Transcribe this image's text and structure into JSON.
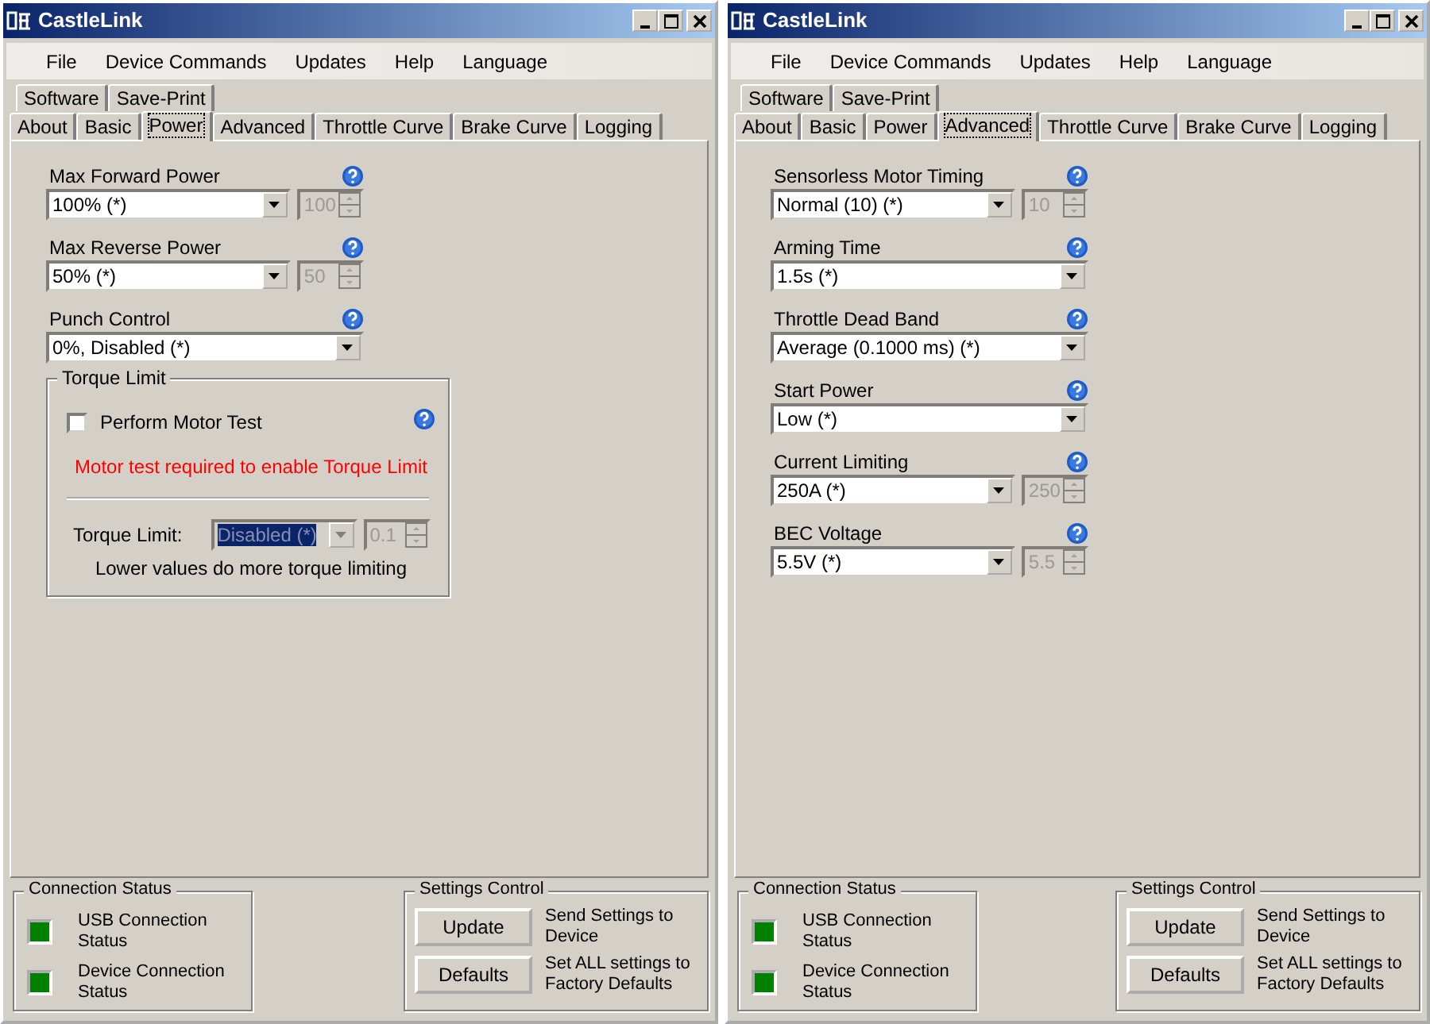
{
  "windows": [
    {
      "title": "CastleLink",
      "menu": [
        "File",
        "Device Commands",
        "Updates",
        "Help",
        "Language"
      ],
      "tab_rows": [
        [
          {
            "label": "Software",
            "selected": false
          },
          {
            "label": "Save-Print",
            "selected": false
          }
        ],
        [
          {
            "label": "About",
            "selected": false
          },
          {
            "label": "Basic",
            "selected": false
          },
          {
            "label": "Power",
            "selected": true
          },
          {
            "label": "Advanced",
            "selected": false
          },
          {
            "label": "Throttle Curve",
            "selected": false
          },
          {
            "label": "Brake Curve",
            "selected": false
          },
          {
            "label": "Logging",
            "selected": false
          }
        ]
      ],
      "settings": [
        {
          "kind": "combo-spin",
          "label": "Max Forward Power",
          "value": "100% (*)",
          "spin": "100"
        },
        {
          "kind": "combo-spin",
          "label": "Max Reverse Power",
          "value": "50% (*)",
          "spin": "50"
        },
        {
          "kind": "combo",
          "label": "Punch Control",
          "value": "0%, Disabled (*)"
        }
      ],
      "torque_limit": {
        "title": "Torque Limit",
        "checkbox": {
          "label": "Perform Motor Test",
          "checked": false
        },
        "warning": "Motor test required to enable Torque Limit",
        "limit_label": "Torque Limit:",
        "limit_value": "Disabled (*)",
        "limit_spin": "0.1",
        "disabled": true,
        "note": "Lower values do more torque limiting"
      },
      "connection_status": {
        "title": "Connection Status",
        "items": [
          {
            "label": "USB Connection Status",
            "on": true
          },
          {
            "label": "Device Connection Status",
            "on": true
          }
        ]
      },
      "settings_control": {
        "title": "Settings Control",
        "buttons": [
          {
            "label": "Update",
            "description": "Send Settings to Device"
          },
          {
            "label": "Defaults",
            "description": "Set ALL settings to Factory Defaults"
          }
        ]
      }
    },
    {
      "title": "CastleLink",
      "menu": [
        "File",
        "Device Commands",
        "Updates",
        "Help",
        "Language"
      ],
      "tab_rows": [
        [
          {
            "label": "Software",
            "selected": false
          },
          {
            "label": "Save-Print",
            "selected": false
          }
        ],
        [
          {
            "label": "About",
            "selected": false
          },
          {
            "label": "Basic",
            "selected": false
          },
          {
            "label": "Power",
            "selected": false
          },
          {
            "label": "Advanced",
            "selected": true
          },
          {
            "label": "Throttle Curve",
            "selected": false
          },
          {
            "label": "Brake Curve",
            "selected": false
          },
          {
            "label": "Logging",
            "selected": false
          }
        ]
      ],
      "settings": [
        {
          "kind": "combo-spin",
          "label": "Sensorless Motor Timing",
          "value": "Normal (10) (*)",
          "spin": "10"
        },
        {
          "kind": "combo",
          "label": "Arming Time",
          "value": "1.5s (*)"
        },
        {
          "kind": "combo",
          "label": "Throttle Dead Band",
          "value": "Average (0.1000 ms) (*)"
        },
        {
          "kind": "combo",
          "label": "Start Power",
          "value": "Low (*)"
        },
        {
          "kind": "combo-spin",
          "label": "Current Limiting",
          "value": "250A (*)",
          "spin": "250"
        },
        {
          "kind": "combo-spin",
          "label": "BEC Voltage",
          "value": "5.5V (*)",
          "spin": "5.5"
        }
      ],
      "connection_status": {
        "title": "Connection Status",
        "items": [
          {
            "label": "USB Connection Status",
            "on": true
          },
          {
            "label": "Device Connection Status",
            "on": true
          }
        ]
      },
      "settings_control": {
        "title": "Settings Control",
        "buttons": [
          {
            "label": "Update",
            "description": "Send Settings to Device"
          },
          {
            "label": "Defaults",
            "description": "Set ALL settings to Factory Defaults"
          }
        ]
      }
    }
  ]
}
